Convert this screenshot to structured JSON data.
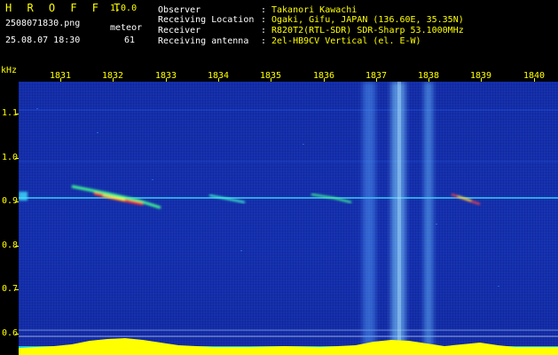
{
  "app": {
    "brand": "H R O F F T",
    "version": "1.0.0",
    "filename": "2508071830.png",
    "datetime": "25.08.07 18:30",
    "meteor_label": "meteor",
    "meteor_count": "61"
  },
  "info": [
    {
      "label": "Observer",
      "sep": ":",
      "value": "Takanori Kawachi"
    },
    {
      "label": "Receiving Location",
      "sep": ":",
      "value": "Ogaki, Gifu, JAPAN (136.60E, 35.35N)"
    },
    {
      "label": "Receiver",
      "sep": ":",
      "value": "R820T2(RTL-SDR) SDR-Sharp 53.1000MHz"
    },
    {
      "label": "Receiving antenna",
      "sep": ":",
      "value": "2el-HB9CV Vertical (el. E-W)"
    }
  ],
  "axes": {
    "y_unit": "kHz",
    "x_ticks": [
      "1831",
      "1832",
      "1833",
      "1834",
      "1835",
      "1836",
      "1837",
      "1838",
      "1839",
      "1840"
    ],
    "y_ticks": [
      "1.1",
      "1.0",
      "0.9",
      "0.8",
      "0.7",
      "0.6"
    ]
  },
  "colors": {
    "text_yellow": "#ffff00",
    "text_white": "#ffffff",
    "plot_blue": "#0a1a8a",
    "signal_cyan": "#40e0ff",
    "signal_red": "#ff3030"
  }
}
